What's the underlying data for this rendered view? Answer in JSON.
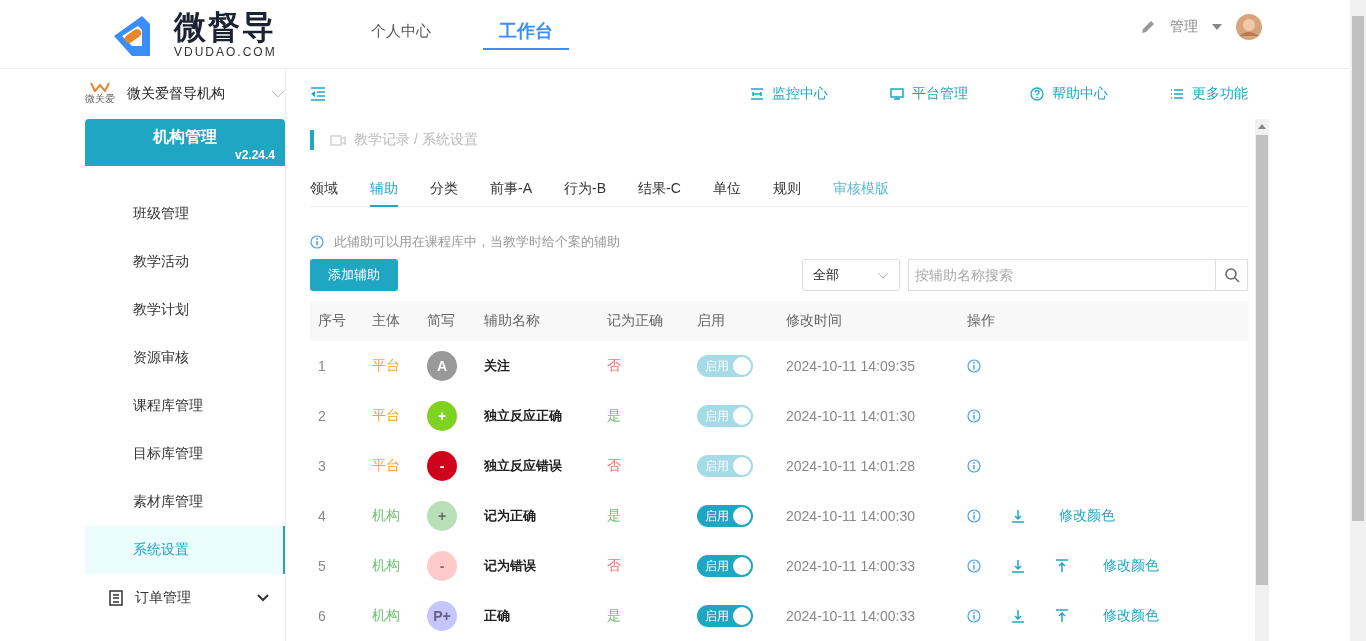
{
  "header": {
    "logo_text": "微督导",
    "logo_sub": "VDUDAO.COM",
    "nav": [
      {
        "label": "个人中心",
        "selected": false
      },
      {
        "label": "工作台",
        "selected": true
      }
    ],
    "user": "管理"
  },
  "sidebar": {
    "org": "微关爱督导机构",
    "org_logo_text": "微关爱",
    "card_title": "机构管理",
    "version": "v2.24.4",
    "items": [
      {
        "label": "班级管理",
        "selected": false
      },
      {
        "label": "教学活动",
        "selected": false
      },
      {
        "label": "教学计划",
        "selected": false
      },
      {
        "label": "资源审核",
        "selected": false
      },
      {
        "label": "课程库管理",
        "selected": false
      },
      {
        "label": "目标库管理",
        "selected": false
      },
      {
        "label": "素材库管理",
        "selected": false
      },
      {
        "label": "系统设置",
        "selected": true
      }
    ],
    "group": {
      "label": "订单管理",
      "expanded": false
    }
  },
  "toolbar": [
    {
      "label": "监控中心",
      "kind": "monitor"
    },
    {
      "label": "平台管理",
      "kind": "screen"
    },
    {
      "label": "帮助中心",
      "kind": "help"
    },
    {
      "label": "更多功能",
      "kind": "list"
    }
  ],
  "breadcrumb": "教学记录 / 系统设置",
  "tabs": [
    {
      "label": "领域",
      "selected": false,
      "kind": "tab"
    },
    {
      "label": "辅助",
      "selected": true,
      "kind": "tab"
    },
    {
      "label": "分类",
      "selected": false,
      "kind": "tab"
    },
    {
      "label": "前事-A",
      "selected": false,
      "kind": "tab"
    },
    {
      "label": "行为-B",
      "selected": false,
      "kind": "tab"
    },
    {
      "label": "结果-C",
      "selected": false,
      "kind": "tab"
    },
    {
      "label": "单位",
      "selected": false,
      "kind": "tab"
    },
    {
      "label": "规则",
      "selected": false,
      "kind": "tab"
    },
    {
      "label": "审核模版",
      "selected": false,
      "kind": "link"
    }
  ],
  "hint": "此辅助可以用在课程库中，当教学时给个案的辅助",
  "add_button": "添加辅助",
  "filter": {
    "value": "全部"
  },
  "search": {
    "placeholder": "按辅助名称搜索"
  },
  "table": {
    "columns": [
      "序号",
      "主体",
      "简写",
      "辅助名称",
      "记为正确",
      "启用",
      "修改时间",
      "操作"
    ],
    "rows": [
      {
        "no": "1",
        "owner": {
          "text": "平台",
          "color": "#f5a623"
        },
        "abbr": "A",
        "color": "#999999",
        "name": "关注",
        "correct": "否",
        "correct_yes": false,
        "switch": "启用",
        "on": true,
        "disabled": true,
        "time": "2024-10-11 14:09:35",
        "actions": [
          {
            "kind": "info"
          }
        ]
      },
      {
        "no": "2",
        "owner": {
          "text": "平台",
          "color": "#f5a623"
        },
        "abbr": "+",
        "color": "#7ed321",
        "name": "独立反应正确",
        "correct": "是",
        "correct_yes": true,
        "switch": "启用",
        "on": true,
        "disabled": true,
        "time": "2024-10-11 14:01:30",
        "actions": [
          {
            "kind": "info"
          }
        ]
      },
      {
        "no": "3",
        "owner": {
          "text": "平台",
          "color": "#f5a623"
        },
        "abbr": "-",
        "color": "#d0021b",
        "name": "独立反应错误",
        "correct": "否",
        "correct_yes": false,
        "switch": "启用",
        "on": true,
        "disabled": true,
        "time": "2024-10-11 14:01:28",
        "actions": [
          {
            "kind": "info"
          }
        ]
      },
      {
        "no": "4",
        "owner": {
          "text": "机构",
          "color": "#6fbf73"
        },
        "abbr": "+",
        "color": "#b9dfb9",
        "name": "记为正确",
        "correct": "是",
        "correct_yes": true,
        "switch": "启用",
        "on": true,
        "disabled": false,
        "time": "2024-10-11 14:00:30",
        "actions": [
          {
            "kind": "info"
          },
          {
            "kind": "down"
          },
          {
            "kind": "link",
            "label": "修改颜色"
          }
        ]
      },
      {
        "no": "5",
        "owner": {
          "text": "机构",
          "color": "#6fbf73"
        },
        "abbr": "-",
        "color": "#ffcaca",
        "name": "记为错误",
        "correct": "否",
        "correct_yes": false,
        "switch": "启用",
        "on": true,
        "disabled": false,
        "time": "2024-10-11 14:00:33",
        "actions": [
          {
            "kind": "info"
          },
          {
            "kind": "down"
          },
          {
            "kind": "up"
          },
          {
            "kind": "link",
            "label": "修改颜色"
          }
        ]
      },
      {
        "no": "6",
        "owner": {
          "text": "机构",
          "color": "#6fbf73"
        },
        "abbr": "P+",
        "color": "#c5c5ff",
        "name": "正确",
        "correct": "是",
        "correct_yes": true,
        "switch": "启用",
        "on": true,
        "disabled": false,
        "time": "2024-10-11 14:00:33",
        "actions": [
          {
            "kind": "info"
          },
          {
            "kind": "down"
          },
          {
            "kind": "up"
          },
          {
            "kind": "link",
            "label": "修改颜色"
          }
        ]
      }
    ]
  }
}
